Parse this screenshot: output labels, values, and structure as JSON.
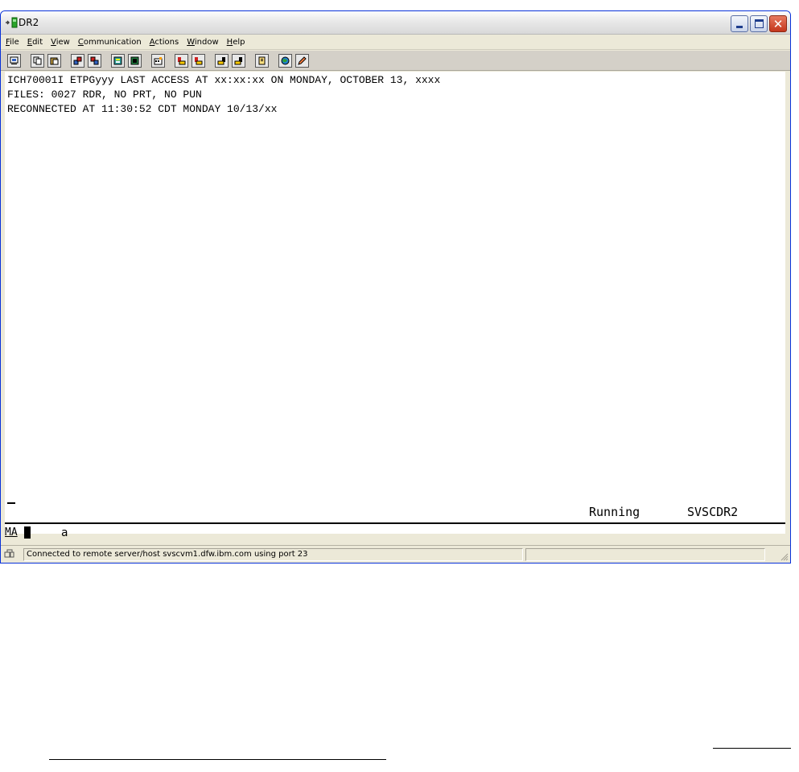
{
  "window": {
    "title": "DR2"
  },
  "menu": {
    "items": [
      {
        "label": "File",
        "accel": "F",
        "rest": "ile"
      },
      {
        "label": "Edit",
        "accel": "E",
        "rest": "dit"
      },
      {
        "label": "View",
        "accel": "V",
        "rest": "iew"
      },
      {
        "label": "Communication",
        "accel": "C",
        "rest": "ommunication"
      },
      {
        "label": "Actions",
        "accel": "A",
        "rest": "ctions"
      },
      {
        "label": "Window",
        "accel": "W",
        "rest": "indow"
      },
      {
        "label": "Help",
        "accel": "H",
        "rest": "elp"
      }
    ]
  },
  "toolbar": {
    "icons": [
      "print-screen-icon",
      "copy-icon",
      "paste-icon",
      "send-file-icon",
      "receive-file-icon",
      "display-setup-icon",
      "keyboard-map-icon",
      "macro-icon",
      "record-macro-icon",
      "play-macro-icon",
      "start-macro-icon",
      "stop-macro-icon",
      "clipboard-icon",
      "web-icon",
      "pencil-icon"
    ]
  },
  "terminal": {
    "line1": "ICH70001I ETPGyyy LAST ACCESS AT xx:xx:xx ON MONDAY, OCTOBER 13, xxxx",
    "line2": "FILES: 0027 RDR, NO PRT, NO PUN",
    "line3": "RECONNECTED AT 11:30:52 CDT MONDAY 10/13/xx",
    "status_running": "Running",
    "status_host": "SVSCDR2"
  },
  "oia": {
    "ma": "MA",
    "indicator": "a"
  },
  "statusbar": {
    "message": "Connected to remote server/host svscvm1.dfw.ibm.com using port 23"
  },
  "colors": {
    "window_border": "#0831d9",
    "close_button": "#c4361c",
    "terminal_background": "#ffffff",
    "terminal_text": "#000000"
  }
}
